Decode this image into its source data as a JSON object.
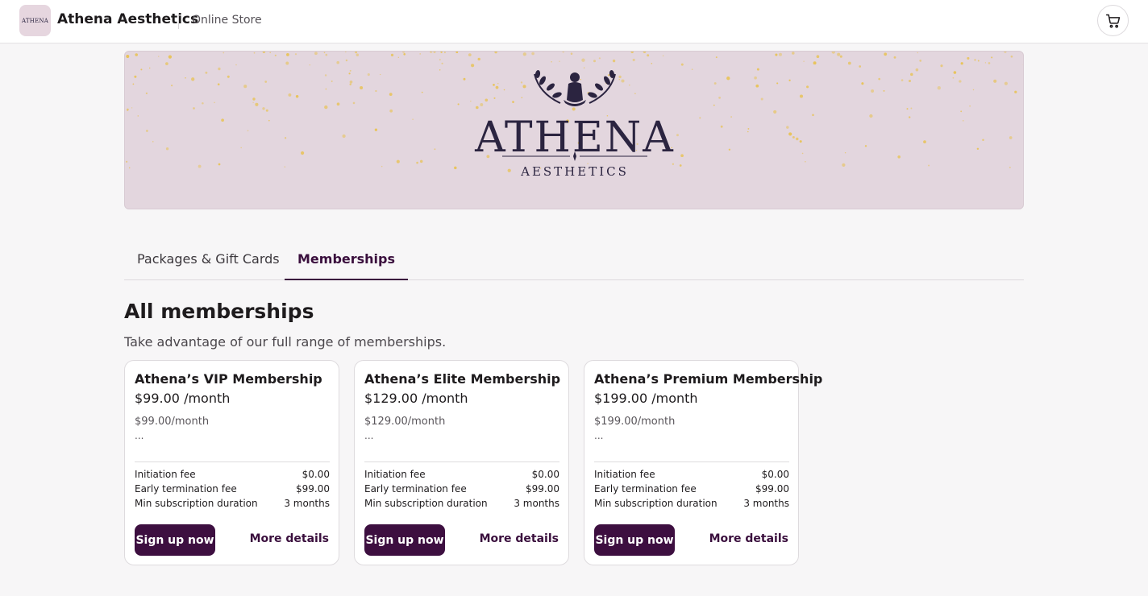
{
  "header": {
    "logo_text": "ATHENA",
    "brand_name": "Athena Aesthetics",
    "store_label": "Online Store",
    "cart_icon": "cart-icon"
  },
  "banner": {
    "title": "ATHENA",
    "subtitle": "AESTHETICS",
    "colors": {
      "background": "#e3d6de",
      "ink": "#2b2440",
      "confetti": "#e8c35a"
    }
  },
  "tabs": [
    {
      "label": "Packages & Gift Cards",
      "active": false
    },
    {
      "label": "Memberships",
      "active": true
    }
  ],
  "main": {
    "heading": "All memberships",
    "subheading": "Take advantage of our full range of memberships."
  },
  "memberships": [
    {
      "title": "Athena’s VIP Membership",
      "price": "$99.00 /month",
      "description": "$99.00/month",
      "ellipsis": "...",
      "fees": [
        {
          "label": "Initiation fee",
          "value": "$0.00"
        },
        {
          "label": "Early termination fee",
          "value": "$99.00"
        },
        {
          "label": "Min subscription duration",
          "value": "3 months"
        }
      ],
      "signup_label": "Sign up now",
      "details_label": "More details"
    },
    {
      "title": "Athena’s Elite Membership",
      "price": "$129.00 /month",
      "description": "$129.00/month",
      "ellipsis": "...",
      "fees": [
        {
          "label": "Initiation fee",
          "value": "$0.00"
        },
        {
          "label": "Early termination fee",
          "value": "$99.00"
        },
        {
          "label": "Min subscription duration",
          "value": "3 months"
        }
      ],
      "signup_label": "Sign up now",
      "details_label": "More details"
    },
    {
      "title": "Athena’s Premium Membership",
      "price": "$199.00 /month",
      "description": "$199.00/month",
      "ellipsis": "...",
      "fees": [
        {
          "label": "Initiation fee",
          "value": "$0.00"
        },
        {
          "label": "Early termination fee",
          "value": "$99.00"
        },
        {
          "label": "Min subscription duration",
          "value": "3 months"
        }
      ],
      "signup_label": "Sign up now",
      "details_label": "More details"
    }
  ],
  "theme": {
    "accent": "#3d0f40",
    "page_background": "#f7f6f7"
  }
}
